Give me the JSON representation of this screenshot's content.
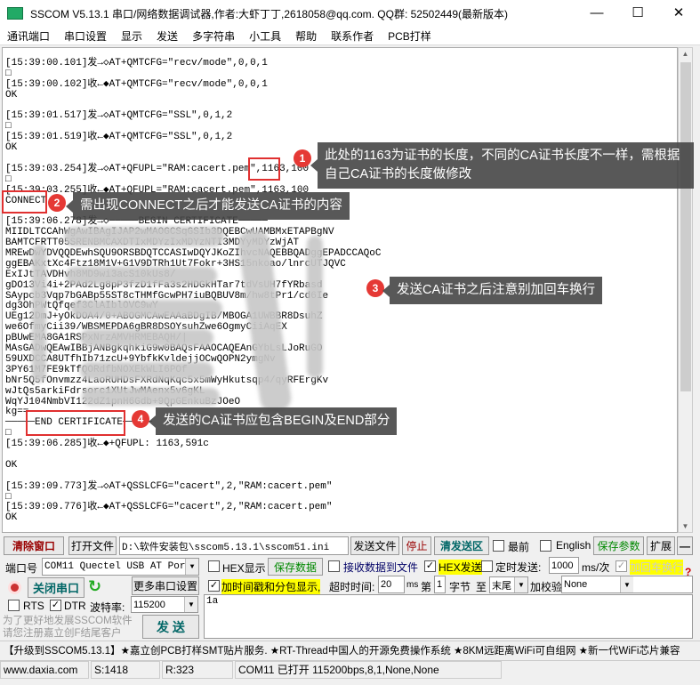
{
  "window": {
    "title": "SSCOM V5.13.1 串口/网络数据调试器,作者:大虾丁丁,2618058@qq.com. QQ群: 52502449(最新版本)",
    "minimize": "—",
    "maximize": "☐",
    "close": "✕"
  },
  "menu": [
    "通讯端口",
    "串口设置",
    "显示",
    "发送",
    "多字符串",
    "小工具",
    "帮助",
    "联系作者",
    "PCB打样"
  ],
  "log": [
    "[15:39:00.101]发→◇AT+QMTCFG=\"recv/mode\",0,0,1",
    "□",
    "[15:39:00.102]收←◆AT+QMTCFG=\"recv/mode\",0,0,1",
    "OK",
    "",
    "[15:39:01.517]发→◇AT+QMTCFG=\"SSL\",0,1,2",
    "□",
    "[15:39:01.519]收←◆AT+QMTCFG=\"SSL\",0,1,2",
    "OK",
    "",
    "[15:39:03.254]发→◇AT+QFUPL=\"RAM:cacert.pem\",1163,100",
    "□",
    "[15:39:03.255]收←◆AT+QFUPL=\"RAM:cacert.pem\",1163,100",
    "CONNECT",
    "",
    "[15:39:06.278]发→◇─────BEGIN CERTIFICATE─────",
    "MIIDLTCCAhWgAwIBAgIJAP2wMAOGCSqGSIb3DQEBCwUAMBMxETAPBgNV",
    "BAMTCFRTT05SRENBMCAXDTIxMDYzIxMDYzNTI3MDYyMDYzWjAT",
    "MREwDwYDVQQDEwhSQU9ORSBDQTCCASIwDQYJKoZIhvcNAQEBBQADggEPADCCAQoC",
    "ggEBAKxtXc4Ftz18M1V+G1V9DTRh1Ut7Fokr+3HS15nkoao/lnrcUTJQVC",
    "ExIJtTAVDHvh8MD9wi3acS10kUs8/",
    "gDO13Vi4i+2PAd2Lg8pP3fzD1fFa3s2HDGkHTar7tdVsUH7fYRbasd",
    "SAypcb3Vqp7bGABp55ST8cTHMfGcwPH7iuBQBUV8m/hw8tPr1/cd6Ie",
    "dg3OhPWtQfqef3ClAIblOVC9wY",
    "UEg12DmJ+yOkDOA4/0+ABOGMCAwEAAaBDgIB/MBOGA1UWBBR8DsuhZ",
    "we6OfmyCii39/WBSMEPDA6gBR8DSOYsuhZwe6OgmyCiiAqEX",
    "pBUwEMA8GA1RSPxNrzAMVHRMEBAQH/|",
    "MAsGADwQEAwIBBjANBgkqhkiG9w0BAQsFAAOCAQEAnGYbLsLJoRuGO",
    "59UXDCCA8UTfhIb71zcU+9YbfkKvldejjOCwQOPN2ymgNv",
    "3PY61M7FE9kTfQORdfbNOXEkWLI6POf",
    "bNr5Q5fOnvmzz4LaoRUHDsFXRdNqKqc5x5mWyHkutsqp4/qyRFErgKv",
    "wJtQs5arkiFdrsorc1XUtJwMAenx5v6gKL",
    "WqYJ104NmbVI122dZ1pnH6Gdb+9QpGEnkuBzJOeO",
    "kg==",
    "─────END CERTIFICATE─────",
    "□",
    "[15:39:06.285]收←◆+QFUPL: 1163,591c",
    "",
    "OK",
    "",
    "[15:39:09.773]发→◇AT+QSSLCFG=\"cacert\",2,\"RAM:cacert.pem\"",
    "□",
    "[15:39:09.776]收←◆AT+QSSLCFG=\"cacert\",2,\"RAM:cacert.pem\"",
    "OK"
  ],
  "callouts": [
    {
      "num": "1",
      "text": "此处的1163为证书的长度，不同的CA证书长度不一样，需根据自己CA证书的长度做修改"
    },
    {
      "num": "2",
      "text": "需出现CONNECT之后才能发送CA证书的内容"
    },
    {
      "num": "3",
      "text": "发送CA证书之后注意别加回车换行"
    },
    {
      "num": "4",
      "text": "发送的CA证书应包含BEGIN及END部分"
    }
  ],
  "toolbar": {
    "clear": "清除窗口",
    "open_file": "打开文件",
    "file_path": "D:\\软件安装包\\sscom5.13.1\\sscom51.ini",
    "send_file": "发送文件",
    "stop": "停止",
    "clear_send": "清发送区",
    "topmost": "最前",
    "english": "English",
    "save_params": "保存参数",
    "expand": "扩展",
    "collapse": "—"
  },
  "port": {
    "label": "端口号",
    "value": "COM11 Quectel USB AT Port",
    "close_port": "关闭串口",
    "more_settings": "更多串口设置",
    "rts": "RTS",
    "dtr": "DTR",
    "baud_label": "波特率:",
    "baud": "115200",
    "promo": "为了更好地发展SSCOM软件\n请您注册嘉立创F结尾客户",
    "send": "发 送"
  },
  "options": {
    "hex_display": "HEX显示",
    "save_data": "保存数据",
    "recv_to_file": "接收数据到文件",
    "hex_send": "HEX发送",
    "timed_send": "定时发送:",
    "interval": "1000",
    "interval_unit": "ms/次",
    "add_crlf": "加回车换行",
    "timestamp": "加时间戳和分包显示,",
    "timeout_label": "超时时间:",
    "timeout": "20",
    "timeout_unit": "ms",
    "nth": "第",
    "byte_from": "1",
    "byte_unit": "字节",
    "to": "至",
    "end": "末尾",
    "checksum_label": "加校验",
    "checksum": "None",
    "help": "?"
  },
  "send_text": "1a",
  "ticker": "【升级到SSCOM5.13.1】★嘉立创PCB打样SMT贴片服务. ★RT-Thread中国人的开源免费操作系统 ★8KM远距离WiFi可自组网 ★新一代WiFi芯片兼容",
  "status": {
    "website": "www.daxia.com",
    "sent": "S:1418",
    "received": "R:323",
    "port_status": "COM11 已打开  115200bps,8,1,None,None"
  }
}
